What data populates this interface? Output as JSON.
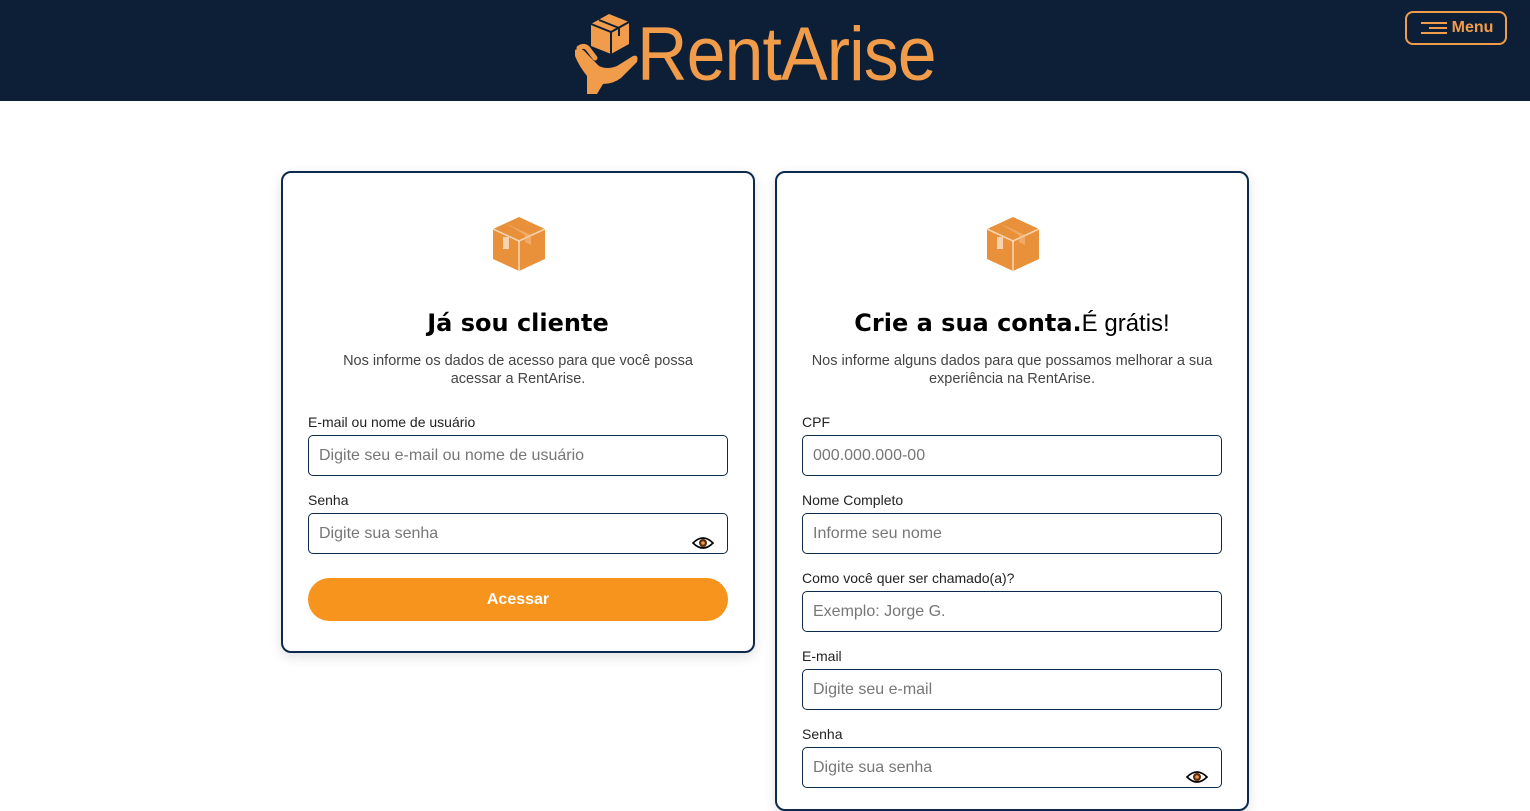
{
  "header": {
    "brand_name": "RentArise",
    "menu_label": "Menu",
    "brand_color": "#f19c4a",
    "background_color": "#0c1f37"
  },
  "login": {
    "title": "Já sou cliente",
    "subtitle": "Nos informe os dados de acesso para que você possa acessar a RentArise.",
    "fields": [
      {
        "label": "E-mail ou nome de usuário",
        "placeholder": "Digite seu e-mail ou nome de usuário"
      },
      {
        "label": "Senha",
        "placeholder": "Digite sua senha",
        "icon": "eye-icon"
      }
    ],
    "submit_label": "Acessar",
    "accent_color": "#f7941d"
  },
  "signup": {
    "title_bold": "Crie a sua conta.",
    "title_light": "É grátis!",
    "subtitle": "Nos informe alguns dados para que possamos melhorar a sua experiência na RentArise.",
    "fields": [
      {
        "label": "CPF",
        "placeholder": "000.000.000-00"
      },
      {
        "label": "Nome Completo",
        "placeholder": "Informe seu nome"
      },
      {
        "label": "Como você quer ser chamado(a)?",
        "placeholder": "Exemplo: Jorge G."
      },
      {
        "label": "E-mail",
        "placeholder": "Digite seu e-mail"
      },
      {
        "label": "Senha",
        "placeholder": "Digite sua senha",
        "icon": "eye-icon"
      }
    ]
  }
}
